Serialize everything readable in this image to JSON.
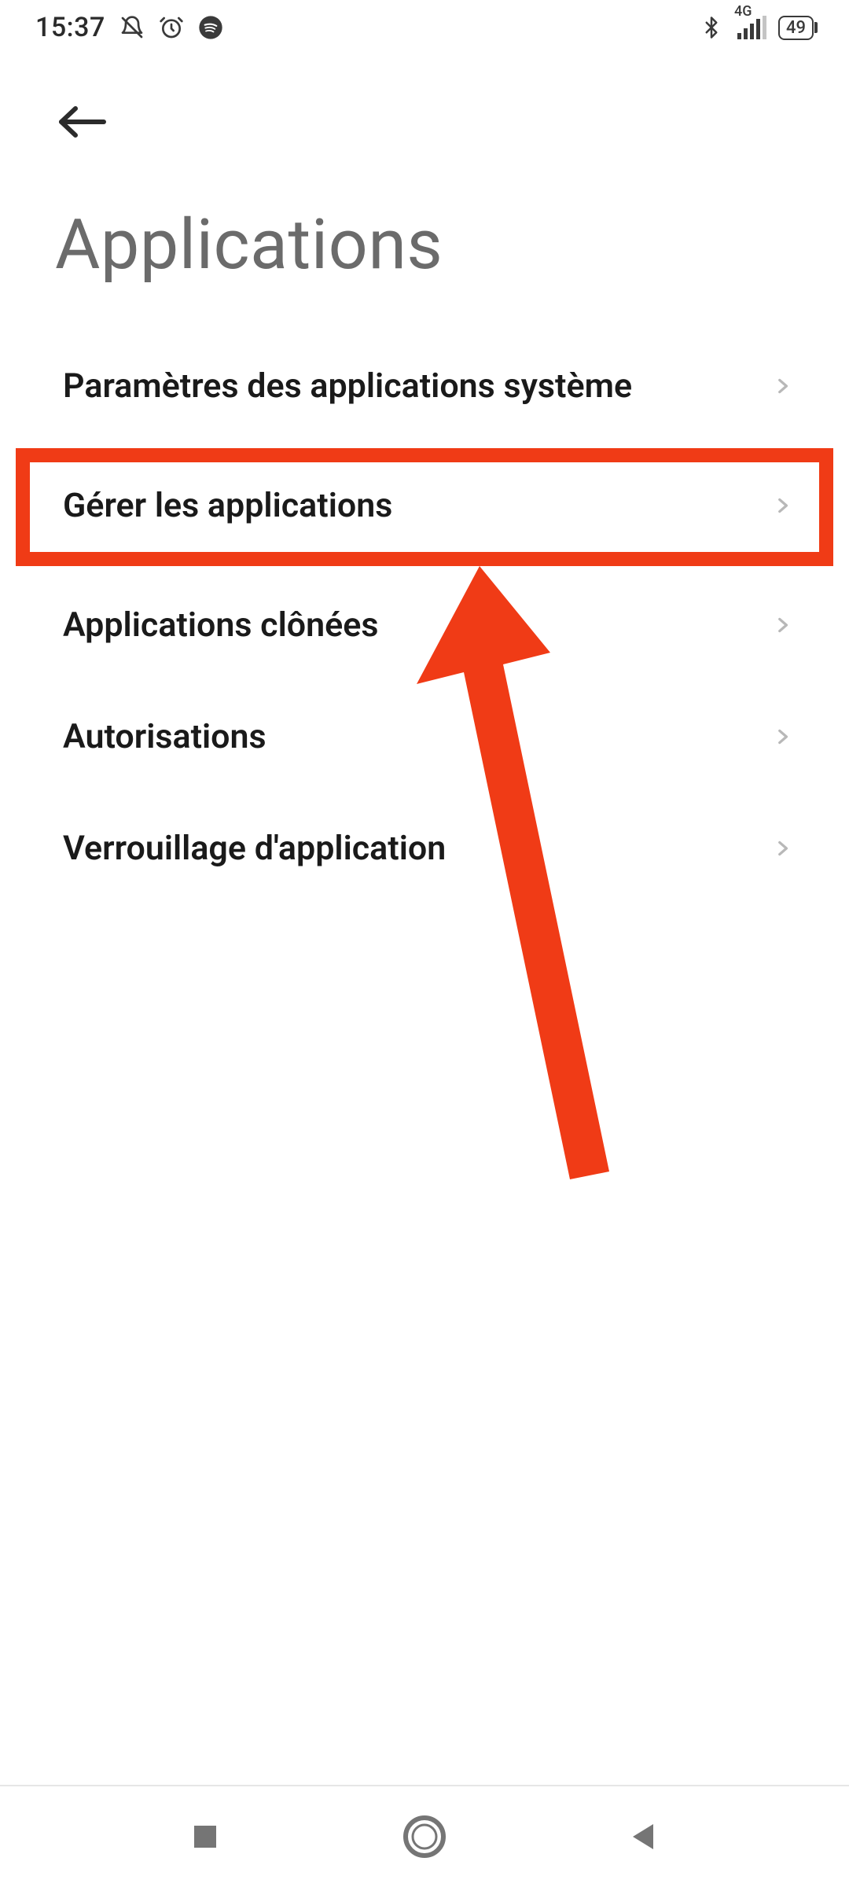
{
  "status": {
    "time": "15:37",
    "network_label": "4G",
    "battery_level": "49",
    "icons_left": [
      "bell-off-icon",
      "alarm-icon",
      "spotify-icon"
    ],
    "icons_right": [
      "bluetooth-icon",
      "signal-icon",
      "battery-icon"
    ]
  },
  "header": {
    "back_icon": "arrow-left-icon"
  },
  "page": {
    "title": "Applications"
  },
  "list": {
    "items": [
      {
        "label": "Paramètres des applications système"
      },
      {
        "label": "Gérer les applications"
      },
      {
        "label": "Applications clônées"
      },
      {
        "label": "Autorisations"
      },
      {
        "label": "Verrouillage d'application"
      }
    ]
  },
  "highlight": {
    "color": "#f03b16",
    "target_index": 1
  },
  "navbar": {
    "buttons": [
      "recent-apps",
      "home",
      "back"
    ]
  }
}
